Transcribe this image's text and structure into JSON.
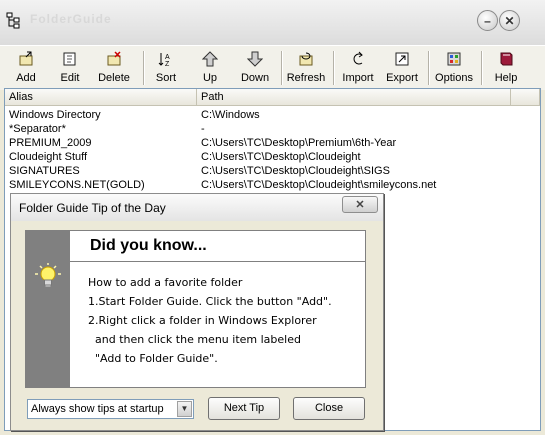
{
  "window": {
    "title": "FolderGuide"
  },
  "toolbar": {
    "items": [
      {
        "label": "Add",
        "icon": "add-icon"
      },
      {
        "label": "Edit",
        "icon": "edit-icon"
      },
      {
        "label": "Delete",
        "icon": "delete-icon"
      },
      {
        "label": "Sort",
        "icon": "sort-icon"
      },
      {
        "label": "Up",
        "icon": "up-arrow-icon"
      },
      {
        "label": "Down",
        "icon": "down-arrow-icon"
      },
      {
        "label": "Refresh",
        "icon": "refresh-icon"
      },
      {
        "label": "Import",
        "icon": "import-icon"
      },
      {
        "label": "Export",
        "icon": "export-icon"
      },
      {
        "label": "Options",
        "icon": "options-icon"
      },
      {
        "label": "Help",
        "icon": "help-book-icon"
      }
    ]
  },
  "list": {
    "columns": [
      "Alias",
      "Path"
    ],
    "rows": [
      {
        "alias": "Windows Directory",
        "path": "C:\\Windows"
      },
      {
        "alias": "*Separator*",
        "path": "-"
      },
      {
        "alias": "PREMIUM_2009",
        "path": "C:\\Users\\TC\\Desktop\\Premium\\6th-Year"
      },
      {
        "alias": "Cloudeight Stuff",
        "path": "C:\\Users\\TC\\Desktop\\Cloudeight"
      },
      {
        "alias": "SIGNATURES",
        "path": "C:\\Users\\TC\\Desktop\\Cloudeight\\SIGS"
      },
      {
        "alias": "SMILEYCONS.NET(GOLD)",
        "path": "C:\\Users\\TC\\Desktop\\Cloudeight\\smileycons.net"
      }
    ]
  },
  "dialog": {
    "title": "Folder Guide Tip of the Day",
    "heading": "Did you know...",
    "lines": [
      "How to add a favorite folder",
      "1.Start Folder Guide. Click the button \"Add\".",
      "2.Right click a folder in Windows Explorer",
      "  and then click the menu item labeled",
      "  \"Add to Folder Guide\"."
    ],
    "startup_option": "Always show tips at startup",
    "next_tip_label": "Next Tip",
    "close_label": "Close",
    "close_x": "✕"
  },
  "colors": {
    "dialog_bg": "#ece9d8",
    "tip_side": "#808080",
    "list_border": "#7f9db9"
  }
}
